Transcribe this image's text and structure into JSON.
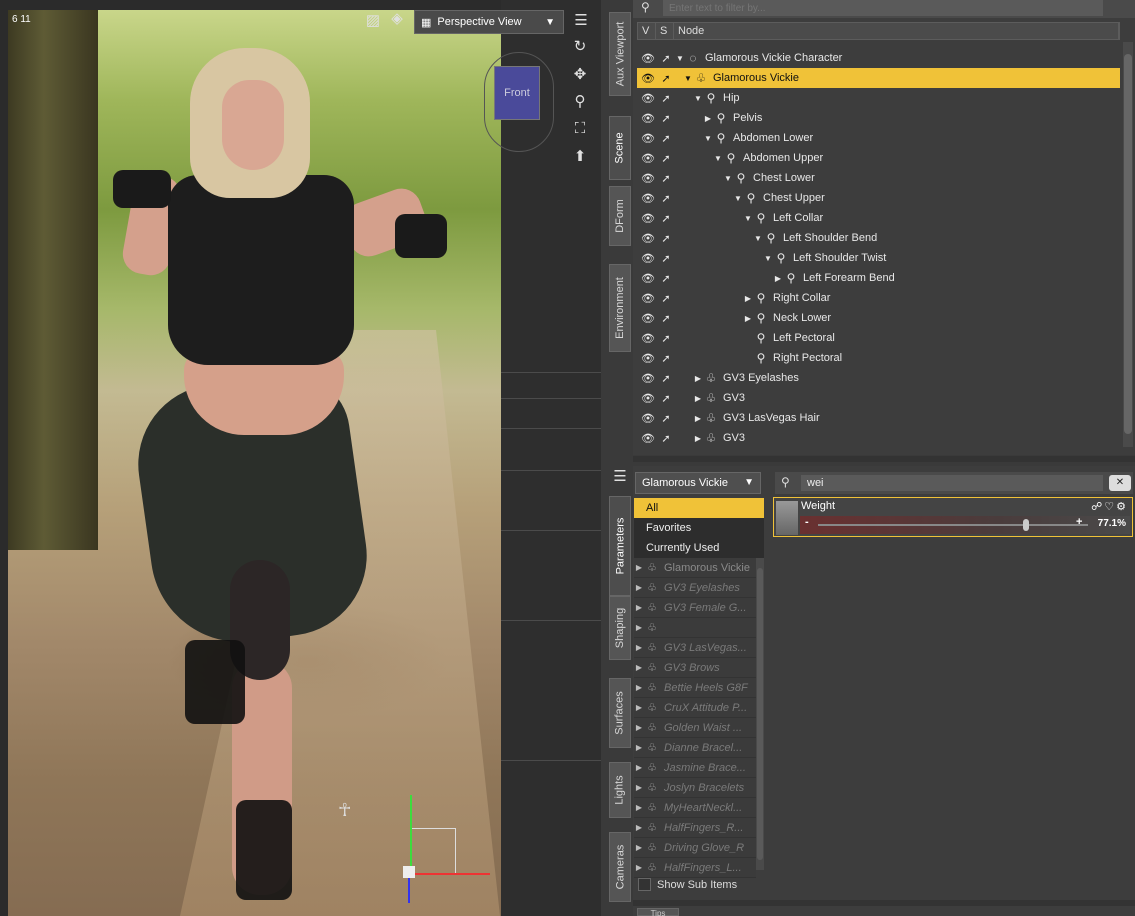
{
  "viewport": {
    "counter": "6 11",
    "view_select": "Perspective View",
    "cube_label": "Front"
  },
  "side_tabs_top": [
    "Aux Viewport",
    "Scene",
    "DForm",
    "Environment"
  ],
  "side_tabs_bottom": [
    "Parameters",
    "Shaping",
    "Surfaces",
    "Lights",
    "Cameras"
  ],
  "scene": {
    "filter_placeholder": "Enter text to filter by...",
    "columns": [
      "V",
      "S",
      "Node"
    ],
    "rows": [
      {
        "label": "Glamorous Vickie Character",
        "level": 0,
        "tri": "▼",
        "icon": "◌"
      },
      {
        "label": "Glamorous Vickie",
        "level": 1,
        "tri": "▼",
        "icon": "♧",
        "selected": true
      },
      {
        "label": "Hip",
        "level": 2,
        "tri": "▼",
        "icon": "⚲"
      },
      {
        "label": "Pelvis",
        "level": 3,
        "tri": "▶",
        "icon": "⚲"
      },
      {
        "label": "Abdomen Lower",
        "level": 3,
        "tri": "▼",
        "icon": "⚲"
      },
      {
        "label": "Abdomen Upper",
        "level": 4,
        "tri": "▼",
        "icon": "⚲"
      },
      {
        "label": "Chest Lower",
        "level": 5,
        "tri": "▼",
        "icon": "⚲"
      },
      {
        "label": "Chest Upper",
        "level": 6,
        "tri": "▼",
        "icon": "⚲"
      },
      {
        "label": "Left Collar",
        "level": 7,
        "tri": "▼",
        "icon": "⚲"
      },
      {
        "label": "Left Shoulder Bend",
        "level": 8,
        "tri": "▼",
        "icon": "⚲"
      },
      {
        "label": "Left Shoulder Twist",
        "level": 9,
        "tri": "▼",
        "icon": "⚲"
      },
      {
        "label": "Left Forearm Bend",
        "level": 10,
        "tri": "▶",
        "icon": "⚲"
      },
      {
        "label": "Right Collar",
        "level": 7,
        "tri": "▶",
        "icon": "⚲"
      },
      {
        "label": "Neck Lower",
        "level": 7,
        "tri": "▶",
        "icon": "⚲"
      },
      {
        "label": "Left Pectoral",
        "level": 7,
        "tri": "",
        "icon": "⚲"
      },
      {
        "label": "Right Pectoral",
        "level": 7,
        "tri": "",
        "icon": "⚲"
      },
      {
        "label": "GV3 Eyelashes",
        "level": 2,
        "tri": "▶",
        "icon": "♧"
      },
      {
        "label": "GV3",
        "level": 2,
        "tri": "▶",
        "icon": "♧"
      },
      {
        "label": "GV3 LasVegas Hair",
        "level": 2,
        "tri": "▶",
        "icon": "♧"
      },
      {
        "label": "GV3",
        "level": 2,
        "tri": "▶",
        "icon": "♧"
      }
    ]
  },
  "params": {
    "node_select": "Glamorous Vickie",
    "categories": [
      "All",
      "Favorites",
      "Currently Used"
    ],
    "objects": [
      "Glamorous Vickie",
      "GV3 Eyelashes",
      "GV3 Female G...",
      "",
      "GV3 LasVegas...",
      "GV3 Brows",
      "Bettie Heels G8F",
      "CruX Attitude P...",
      "Golden Waist ...",
      "Dianne Bracel...",
      "Jasmine Brace...",
      "Joslyn Bracelets",
      "MyHeartNeckl...",
      "HalfFingers_R...",
      "Driving Glove_R",
      "HalfFingers_L..."
    ],
    "show_sub_items": "Show Sub Items",
    "search_value": "wei",
    "weight_label": "Weight",
    "weight_value": "77.1%",
    "weight_fraction": 0.771
  },
  "tips_label": "Tips",
  "colors": {
    "selection": "#f0c238"
  }
}
